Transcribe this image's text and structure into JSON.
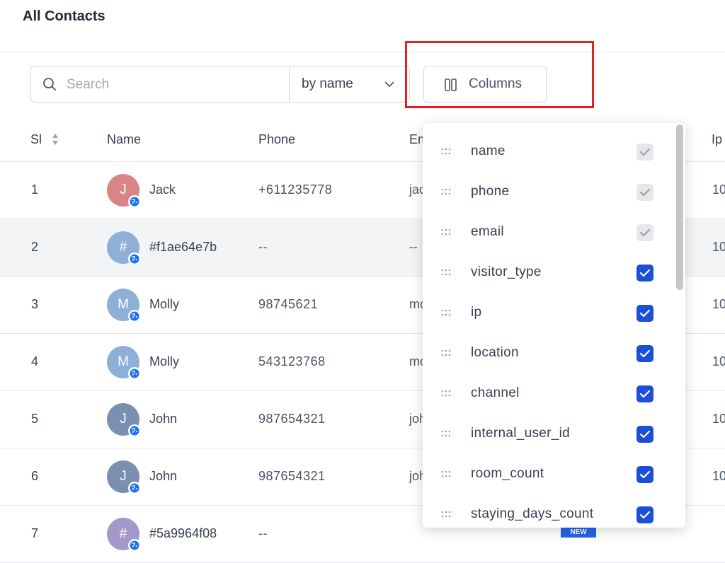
{
  "page": {
    "title": "All Contacts"
  },
  "search": {
    "placeholder": "Search",
    "value": "",
    "by": "by name"
  },
  "columns_button": {
    "label": "Columns"
  },
  "table": {
    "headers": {
      "si": "Sl",
      "name": "Name",
      "phone": "Phone",
      "email": "Em",
      "ip": "Ip"
    },
    "rows": [
      {
        "si": "1",
        "initial": "J",
        "name": "Jack",
        "phone": "+611235778",
        "email": "jac",
        "ip": "10",
        "avatar_color": "#d98585"
      },
      {
        "si": "2",
        "initial": "#",
        "name": "#f1ae64e7b",
        "phone": "--",
        "email": "--",
        "ip": "10",
        "avatar_color": "#8fb0d6"
      },
      {
        "si": "3",
        "initial": "M",
        "name": "Molly",
        "phone": "98745621",
        "email": "mo",
        "ip": "10",
        "avatar_color": "#8fb0d6"
      },
      {
        "si": "4",
        "initial": "M",
        "name": "Molly",
        "phone": "543123768",
        "email": "mo",
        "ip": "10",
        "avatar_color": "#8fb0d6"
      },
      {
        "si": "5",
        "initial": "J",
        "name": "John",
        "phone": "987654321",
        "email": "joh",
        "ip": "10",
        "avatar_color": "#7b8fb0"
      },
      {
        "si": "6",
        "initial": "J",
        "name": "John",
        "phone": "987654321",
        "email": "joh",
        "ip": "10",
        "avatar_color": "#7b8fb0"
      },
      {
        "si": "7",
        "initial": "#",
        "name": "#5a9964f08",
        "phone": "--",
        "email": "",
        "ip": "",
        "avatar_color": "#a398c9"
      }
    ],
    "new_badge": "NEW"
  },
  "column_menu": {
    "items": [
      {
        "label": "name",
        "checked": true,
        "disabled": true
      },
      {
        "label": "phone",
        "checked": true,
        "disabled": true
      },
      {
        "label": "email",
        "checked": true,
        "disabled": true
      },
      {
        "label": "visitor_type",
        "checked": true,
        "disabled": false
      },
      {
        "label": "ip",
        "checked": true,
        "disabled": false
      },
      {
        "label": "location",
        "checked": true,
        "disabled": false
      },
      {
        "label": "channel",
        "checked": true,
        "disabled": false
      },
      {
        "label": "internal_user_id",
        "checked": true,
        "disabled": false
      },
      {
        "label": "room_count",
        "checked": true,
        "disabled": false
      },
      {
        "label": "staying_days_count",
        "checked": true,
        "disabled": false
      }
    ]
  },
  "colors": {
    "accent": "#1d4ed8",
    "highlight": "#e02424",
    "badge": "#1d6ff2"
  }
}
